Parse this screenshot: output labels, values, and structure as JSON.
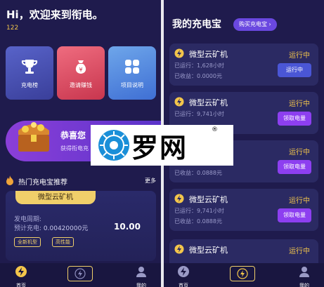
{
  "left": {
    "greeting": "Hi，欢迎来到衔电。",
    "user_id": "122",
    "cards": [
      {
        "label": "充电榜",
        "icon": "trophy-icon"
      },
      {
        "label": "邀请赚钱",
        "icon": "money-bag-icon"
      },
      {
        "label": "项目说明",
        "icon": "grid-icon"
      }
    ],
    "banner": {
      "title": "恭喜您",
      "subtitle": "获得衔电充",
      "icon": "treasure-chest-icon"
    },
    "hot": {
      "title": "热门充电宝推荐",
      "more": "更多",
      "icon": "flame-icon"
    },
    "product": {
      "name": "微型云矿机",
      "period_label": "发电周期:",
      "estimate_label": "预计充电:",
      "estimate_value": "0.00420000元",
      "price": "10.00",
      "chips": [
        "全新机型",
        "高性能"
      ]
    },
    "tabbar": {
      "home": "首页",
      "mine": "我的"
    }
  },
  "right": {
    "title": "我的充电宝",
    "buy_button": "购买充电宝",
    "machines": [
      {
        "name": "微型云矿机",
        "status": "运行中",
        "run": "已运行：1,628小时",
        "earn": "已收益：0.0000元",
        "action": "运行中",
        "action_style": "blue"
      },
      {
        "name": "微型云矿机",
        "status": "运行中",
        "run": "已运行：9,741小时",
        "earn": "",
        "action": "领取电量",
        "action_style": "purple"
      },
      {
        "name": "",
        "status": "运行中",
        "run": "",
        "earn": "已收益：0.0888元",
        "action": "领取电量",
        "action_style": "purple"
      },
      {
        "name": "微型云矿机",
        "status": "运行中",
        "run": "已运行：9,741小时",
        "earn": "已收益：0.0888元",
        "action": "领取电量",
        "action_style": "purple"
      },
      {
        "name": "微型云矿机",
        "status": "运行中",
        "run": "",
        "earn": "",
        "action": "",
        "action_style": ""
      }
    ],
    "tabbar": {
      "home": "首页",
      "mine": "我的"
    }
  },
  "overlay": {
    "text": "罗网",
    "reg": "®",
    "icon": "spider-logo-icon"
  },
  "colors": {
    "background": "#1f1b4d",
    "accent_gold": "#f0cf6a",
    "status_yellow": "#f3c64b",
    "purple": "#8d3ff0",
    "blue": "#4a56d6"
  }
}
